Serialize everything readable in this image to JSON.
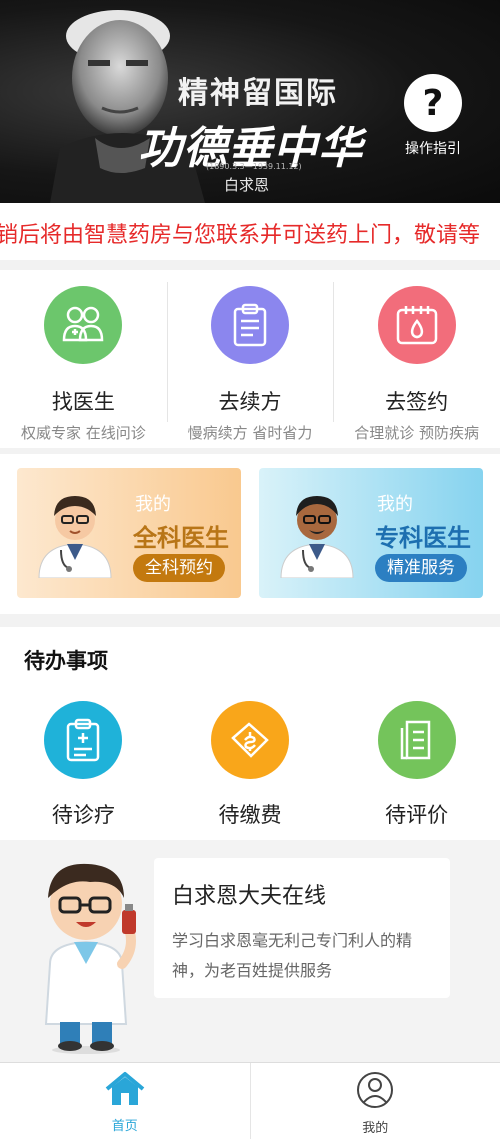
{
  "banner": {
    "line1": "精神留国际",
    "line2": "功德垂中华",
    "dates": "(1890.3.3—1939.11.12)",
    "name": "白求恩",
    "guide_label": "操作指引",
    "guide_icon": "question-icon"
  },
  "notice": {
    "text": "销后将由智慧药房与您联系并可送药上门，敬请等",
    "color": "#e62a2a"
  },
  "services": [
    {
      "title": "找医生",
      "subtitle": "权威专家 在线问诊",
      "icon": "doctors-icon",
      "color": "#6cc66c"
    },
    {
      "title": "去续方",
      "subtitle": "慢病续方 省时省力",
      "icon": "clipboard-icon",
      "color": "#8b86ee"
    },
    {
      "title": "去签约",
      "subtitle": "合理就诊 预防疾病",
      "icon": "calendar-drop-icon",
      "color": "#f26d7b"
    }
  ],
  "cards": {
    "general": {
      "my": "我的",
      "name": "全科医生",
      "action": "全科预约"
    },
    "special": {
      "my": "我的",
      "name": "专科医生",
      "action": "精准服务"
    }
  },
  "todo": {
    "title": "待办事项",
    "items": [
      {
        "label": "待诊疗",
        "icon": "medical-record-icon",
        "color": "#1fb2d9"
      },
      {
        "label": "待缴费",
        "icon": "payment-icon",
        "color": "#f9a61a"
      },
      {
        "label": "待评价",
        "icon": "review-icon",
        "color": "#74c45b"
      }
    ]
  },
  "promo": {
    "title": "白求恩大夫在线",
    "desc": "学习白求恩毫无利己专门利人的精神，为老百姓提供服务"
  },
  "tabbar": {
    "home": "首页",
    "mine": "我的",
    "active_color": "#2aa6d8"
  }
}
